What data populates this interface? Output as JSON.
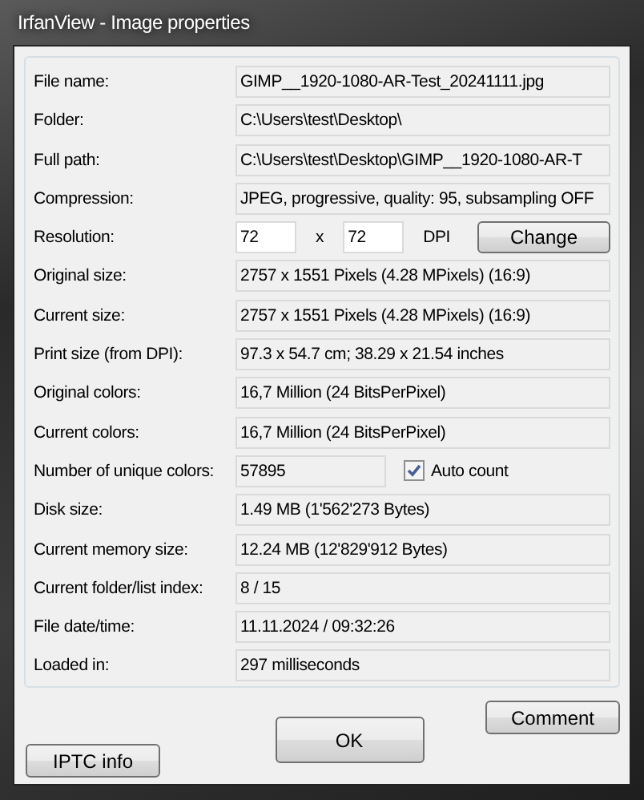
{
  "window": {
    "title": "IrfanView - Image properties"
  },
  "rows": [
    {
      "kind": "text",
      "label": "File name:",
      "value": "GIMP__1920-1080-AR-Test_20241111.jpg"
    },
    {
      "kind": "text",
      "label": "Folder:",
      "value": "C:\\Users\\test\\Desktop\\"
    },
    {
      "kind": "text",
      "label": "Full path:",
      "value": "C:\\Users\\test\\Desktop\\GIMP__1920-1080-AR-T"
    },
    {
      "kind": "text",
      "label": "Compression:",
      "value": "JPEG, progressive, quality: 95, subsampling OFF"
    },
    {
      "kind": "resolution",
      "label": "Resolution:",
      "x_value": "72",
      "separator": "x",
      "y_value": "72",
      "unit": "DPI",
      "button": "Change"
    },
    {
      "kind": "text",
      "label": "Original size:",
      "value": "2757 x 1551  Pixels (4.28 MPixels) (16:9)"
    },
    {
      "kind": "text",
      "label": "Current size:",
      "value": "2757 x 1551  Pixels (4.28 MPixels) (16:9)"
    },
    {
      "kind": "text",
      "label": "Print size (from DPI):",
      "value": "97.3 x 54.7 cm; 38.29 x 21.54 inches"
    },
    {
      "kind": "text",
      "label": "Original colors:",
      "value": "16,7 Million   (24 BitsPerPixel)"
    },
    {
      "kind": "text",
      "label": "Current colors:",
      "value": "16,7 Million   (24 BitsPerPixel)"
    },
    {
      "kind": "count",
      "label": "Number of unique colors:",
      "value": "57895",
      "checkbox": {
        "label": "Auto count",
        "checked": true
      }
    },
    {
      "kind": "text",
      "label": "Disk size:",
      "value": "1.49 MB (1'562'273 Bytes)"
    },
    {
      "kind": "text",
      "label": "Current memory size:",
      "value": "12.24  MB (12'829'912 Bytes)"
    },
    {
      "kind": "text",
      "label": "Current folder/list index:",
      "value": "8  /  15"
    },
    {
      "kind": "text",
      "label": "File date/time:",
      "value": "11.11.2024 / 09:32:26"
    },
    {
      "kind": "text",
      "label": "Loaded in:",
      "value": "297 milliseconds"
    }
  ],
  "buttons": {
    "iptc": "IPTC info",
    "ok": "OK",
    "comment": "Comment"
  }
}
